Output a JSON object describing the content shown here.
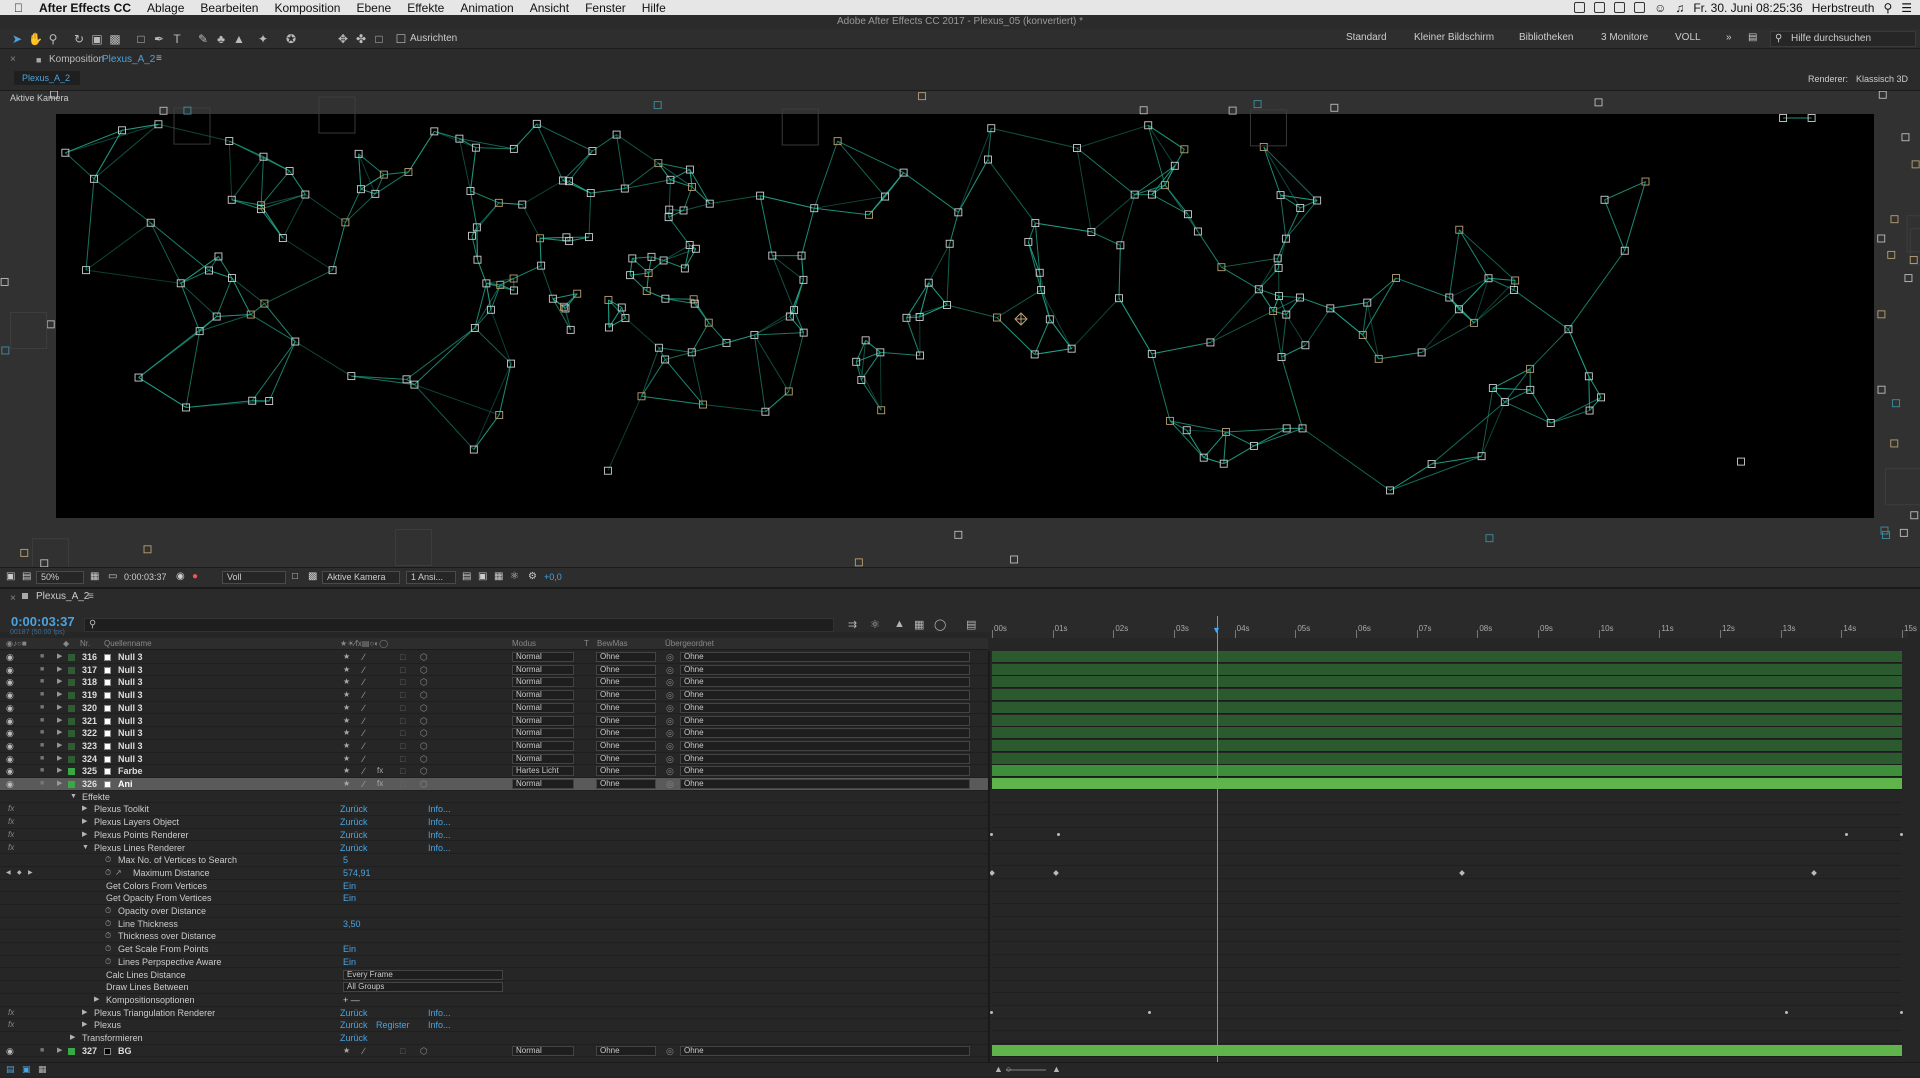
{
  "menubar": {
    "app": "After Effects CC",
    "items": [
      "Ablage",
      "Bearbeiten",
      "Komposition",
      "Ebene",
      "Effekte",
      "Animation",
      "Ansicht",
      "Fenster",
      "Hilfe"
    ],
    "datetime": "Fr. 30. Juni  08:25:36",
    "user": "Herbstreuth"
  },
  "window_title": "Adobe After Effects CC 2017 - Plexus_05 (konvertiert) *",
  "toolbar": {
    "align_label": "Ausrichten",
    "workspaces": [
      "Standard",
      "Kleiner Bildschirm",
      "Bibliotheken",
      "3 Monitore",
      "VOLL"
    ],
    "help_placeholder": "Hilfe durchsuchen"
  },
  "composition": {
    "panel_label": "Komposition",
    "comp_name": "Plexus_A_2",
    "tab": "Plexus_A_2",
    "renderer_label": "Renderer:",
    "renderer_value": "Klassisch 3D",
    "camera_label": "Aktive Kamera"
  },
  "viewer_controls": {
    "zoom": "50%",
    "timecode": "0:00:03:37",
    "resolution": "Voll",
    "camera": "Aktive Kamera",
    "views": "1 Ansi...",
    "exposure": "+0,0"
  },
  "timeline": {
    "tab": "Plexus_A_2",
    "timecode": "0:00:03:37",
    "frame_info": "00187 (50.00 fps)",
    "columns": {
      "nr": "Nr.",
      "source": "Quellenname",
      "mode": "Modus",
      "t": "T",
      "trkmat": "BewMas",
      "parent": "Übergeordnet"
    },
    "ruler_labels": [
      "00s",
      "01s",
      "02s",
      "03s",
      "04s",
      "05s",
      "06s",
      "07s",
      "08s",
      "09s",
      "10s",
      "11s",
      "12s",
      "13s",
      "14s",
      "15s"
    ],
    "layers": [
      {
        "nr": "316",
        "name": "Null 3",
        "mode": "Normal",
        "trk": "Ohne",
        "parent": "Ohne"
      },
      {
        "nr": "317",
        "name": "Null 3",
        "mode": "Normal",
        "trk": "Ohne",
        "parent": "Ohne"
      },
      {
        "nr": "318",
        "name": "Null 3",
        "mode": "Normal",
        "trk": "Ohne",
        "parent": "Ohne"
      },
      {
        "nr": "319",
        "name": "Null 3",
        "mode": "Normal",
        "trk": "Ohne",
        "parent": "Ohne"
      },
      {
        "nr": "320",
        "name": "Null 3",
        "mode": "Normal",
        "trk": "Ohne",
        "parent": "Ohne"
      },
      {
        "nr": "321",
        "name": "Null 3",
        "mode": "Normal",
        "trk": "Ohne",
        "parent": "Ohne"
      },
      {
        "nr": "322",
        "name": "Null 3",
        "mode": "Normal",
        "trk": "Ohne",
        "parent": "Ohne"
      },
      {
        "nr": "323",
        "name": "Null 3",
        "mode": "Normal",
        "trk": "Ohne",
        "parent": "Ohne"
      },
      {
        "nr": "324",
        "name": "Null 3",
        "mode": "Normal",
        "trk": "Ohne",
        "parent": "Ohne"
      },
      {
        "nr": "325",
        "name": "Farbe",
        "mode": "Hartes Licht",
        "trk": "Ohne",
        "parent": "Ohne"
      },
      {
        "nr": "326",
        "name": "Ani",
        "mode": "Normal",
        "trk": "Ohne",
        "parent": "Ohne"
      }
    ],
    "effects": {
      "group": "Effekte",
      "items": [
        {
          "name": "Plexus Toolkit",
          "reset": "Zurück",
          "info": "Info..."
        },
        {
          "name": "Plexus Layers Object",
          "reset": "Zurück",
          "info": "Info..."
        },
        {
          "name": "Plexus Points Renderer",
          "reset": "Zurück",
          "info": "Info..."
        },
        {
          "name": "Plexus Lines Renderer",
          "reset": "Zurück",
          "info": "Info..."
        }
      ],
      "properties": [
        {
          "name": "Max No. of Vertices to Search",
          "value": "5"
        },
        {
          "name": "Maximum Distance",
          "value": "574,91"
        },
        {
          "name": "Get Colors From Vertices",
          "value": "Ein"
        },
        {
          "name": "Get Opacity From Vertices",
          "value": "Ein"
        },
        {
          "name": "Opacity over Distance",
          "value": ""
        },
        {
          "name": "Line Thickness",
          "value": "3,50"
        },
        {
          "name": "Thickness over Distance",
          "value": ""
        },
        {
          "name": "Get Scale From Points",
          "value": "Ein"
        },
        {
          "name": "Lines Perpspective Aware",
          "value": "Ein"
        },
        {
          "name": "Calc Lines Distance",
          "value": "Every Frame"
        },
        {
          "name": "Draw Lines Between",
          "value": "All Groups"
        },
        {
          "name": "Kompositionsoptionen",
          "value": "+ —"
        }
      ],
      "after": [
        {
          "name": "Plexus Triangulation Renderer",
          "reset": "Zurück",
          "info": "Info..."
        },
        {
          "name": "Plexus",
          "reset": "Zurück",
          "register": "Register",
          "info": "Info..."
        }
      ],
      "transform": {
        "name": "Transformieren",
        "reset": "Zurück"
      }
    },
    "bg_layer": {
      "nr": "327",
      "name": "BG",
      "mode": "Normal",
      "trk": "Ohne",
      "parent": "Ohne"
    }
  },
  "colors": {
    "accent": "#3ea6ff",
    "track": "#2a5a2d",
    "track_active": "#5fb54c",
    "node": "#21a58a"
  }
}
